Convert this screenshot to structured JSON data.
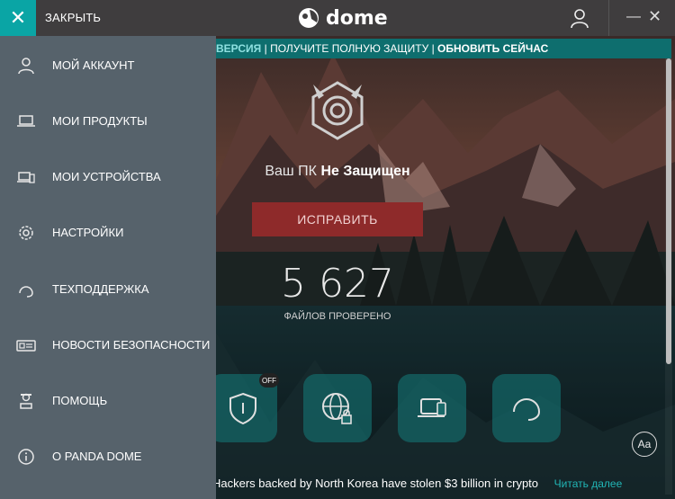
{
  "titlebar": {
    "close_label": "ЗАКРЫТЬ",
    "logo_text": "dome",
    "logo_brand": "panda"
  },
  "banner": {
    "prefix": "ВЕРСИЯ",
    "middle": "ПОЛУЧИТЕ ПОЛНУЮ ЗАЩИТУ",
    "action": "ОБНОВИТЬ СЕЙЧАС"
  },
  "status": {
    "prefix": "Ваш ПК",
    "state": "Не Защищен",
    "fix_label": "ИСПРАВИТЬ",
    "files_count": "5 627",
    "files_label": "ФАЙЛОВ ПРОВЕРЕНО",
    "off_badge": "OFF",
    "font_button": "Aa"
  },
  "news": {
    "text": "Hackers backed by North Korea have stolen $3 billion in crypto",
    "link": "Читать далее"
  },
  "menu": {
    "items": [
      {
        "label": "МОЙ АККАУНТ",
        "icon": "user-icon"
      },
      {
        "label": "МОИ ПРОДУКТЫ",
        "icon": "laptop-icon"
      },
      {
        "label": "МОИ УСТРОЙСТВА",
        "icon": "devices-icon"
      },
      {
        "label": "НАСТРОЙКИ",
        "icon": "gear-icon"
      },
      {
        "label": "ТЕХПОДДЕРЖКА",
        "icon": "headset-icon"
      },
      {
        "label": "НОВОСТИ БЕЗОПАСНОСТИ",
        "icon": "newspaper-icon"
      },
      {
        "label": "ПОМОЩЬ",
        "icon": "help-agent-icon"
      },
      {
        "label": "О PANDA DOME",
        "icon": "info-icon"
      }
    ]
  },
  "colors": {
    "accent": "#0aa5a5",
    "fix_button": "#8e2a2a",
    "sidebar": "#56626b",
    "banner": "#0e6e6e",
    "link": "#21b6b6"
  }
}
